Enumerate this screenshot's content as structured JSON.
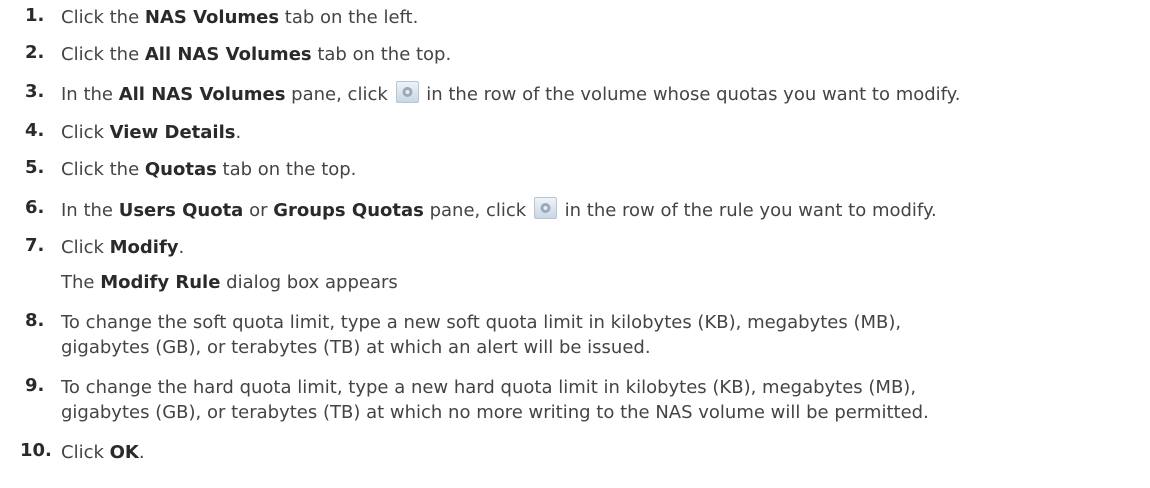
{
  "steps": [
    {
      "num": "1.",
      "parts": [
        "Click the ",
        "NAS Volumes",
        " tab on the left."
      ]
    },
    {
      "num": "2.",
      "parts": [
        "Click the ",
        "All NAS Volumes",
        " tab on the top."
      ]
    },
    {
      "num": "3.",
      "parts": [
        "In the ",
        "All NAS Volumes",
        " pane, click ",
        " in the row of the volume whose quotas you want to modify."
      ]
    },
    {
      "num": "4.",
      "parts": [
        "Click ",
        "View Details",
        "."
      ]
    },
    {
      "num": "5.",
      "parts": [
        "Click the ",
        "Quotas",
        " tab on the top."
      ]
    },
    {
      "num": "6.",
      "parts": [
        "In the ",
        "Users Quota",
        " or ",
        "Groups Quotas",
        " pane, click ",
        " in the row of the rule you want to modify."
      ]
    },
    {
      "num": "7.",
      "parts": [
        "Click ",
        "Modify",
        "."
      ],
      "note": [
        "The ",
        "Modify Rule",
        " dialog box appears"
      ]
    },
    {
      "num": "8.",
      "lines": [
        "To change the soft quota limit, type a new soft quota limit in kilobytes (KB), megabytes (MB),",
        "gigabytes (GB), or terabytes (TB) at which an alert will be issued."
      ]
    },
    {
      "num": "9.",
      "lines": [
        "To change the hard quota limit, type a new hard quota limit in kilobytes (KB), megabytes (MB),",
        "gigabytes (GB), or terabytes (TB) at which no more writing to the NAS volume will be permitted."
      ]
    },
    {
      "num": "10.",
      "parts": [
        "Click ",
        "OK",
        "."
      ]
    }
  ],
  "icons": {
    "action": "gear-icon"
  }
}
